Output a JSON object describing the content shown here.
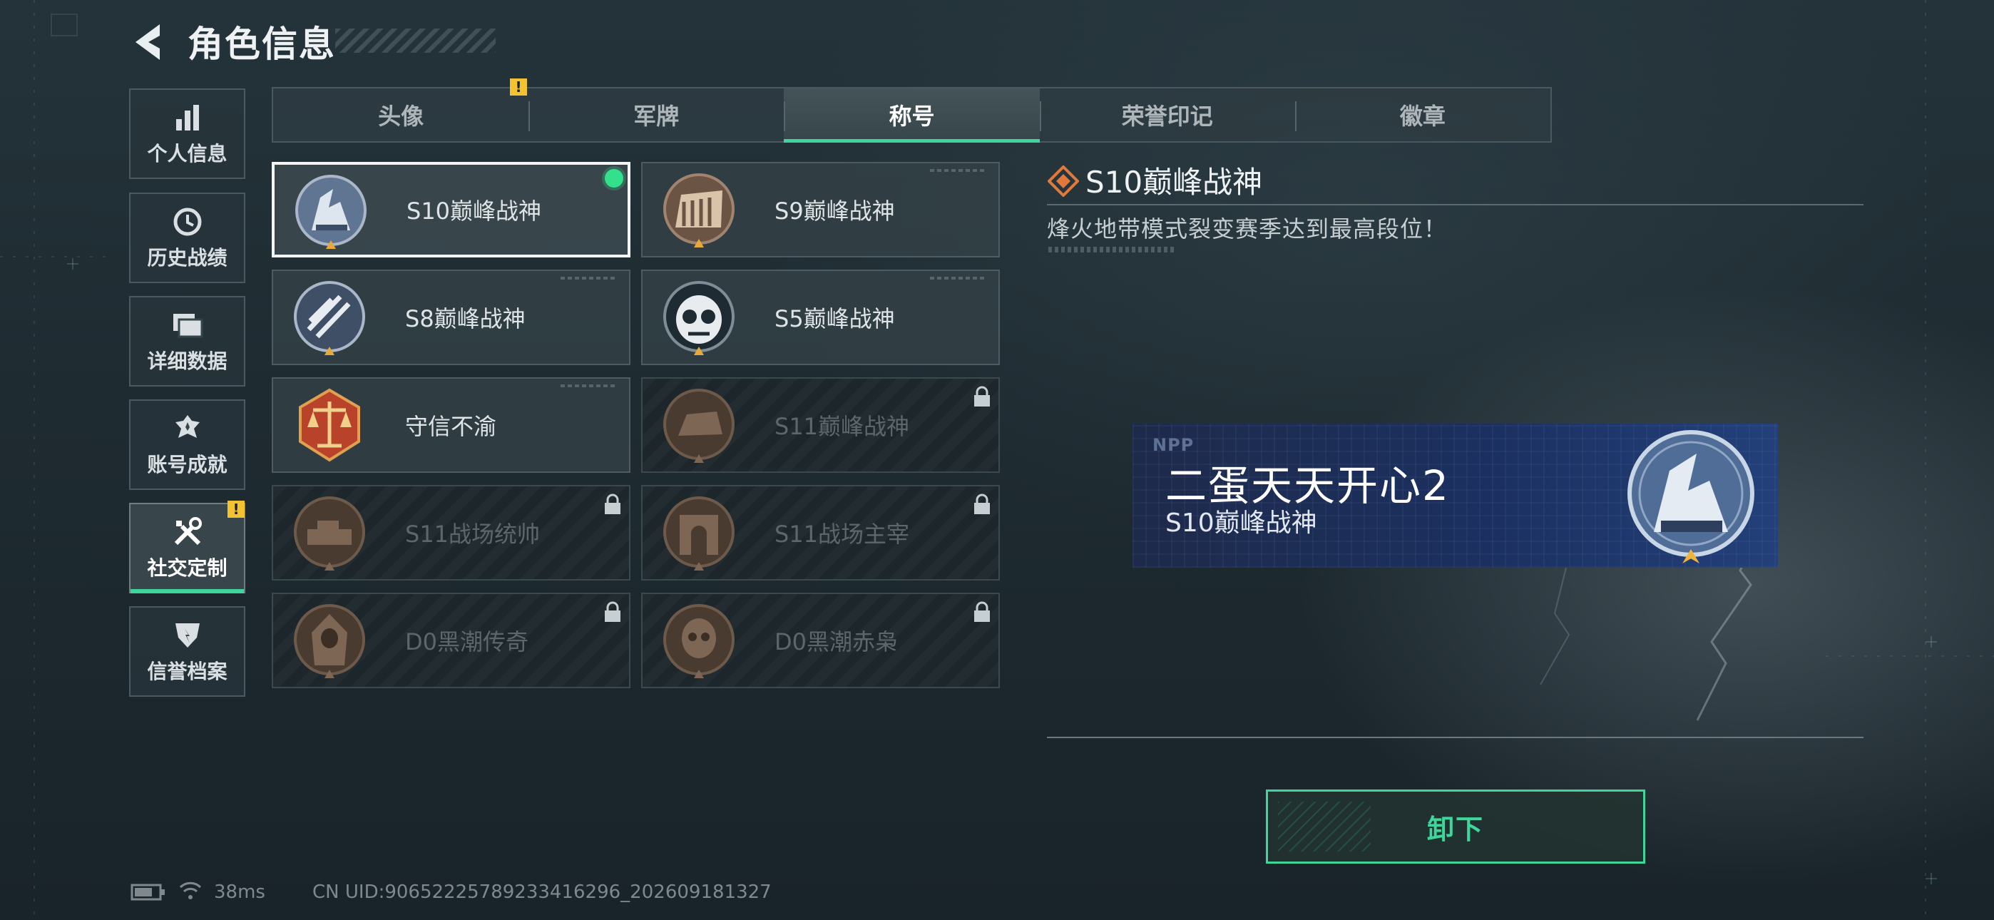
{
  "header": {
    "title": "角色信息"
  },
  "sidebar": {
    "items": [
      {
        "label": "个人信息",
        "icon": "bar-chart-icon"
      },
      {
        "label": "历史战绩",
        "icon": "clock-icon"
      },
      {
        "label": "详细数据",
        "icon": "folder-icon"
      },
      {
        "label": "账号成就",
        "icon": "achievement-icon"
      },
      {
        "label": "社交定制",
        "icon": "tools-icon",
        "active": true,
        "alert": "!"
      },
      {
        "label": "信誉档案",
        "icon": "shield-icon"
      }
    ]
  },
  "tabs": {
    "items": [
      {
        "label": "头像"
      },
      {
        "label": "军牌"
      },
      {
        "label": "称号",
        "active": true
      },
      {
        "label": "荣誉印记"
      },
      {
        "label": "徽章"
      }
    ],
    "alert": "!"
  },
  "titles": [
    {
      "name": "S10巅峰战神",
      "state": "equipped",
      "icon": "s10-emblem-icon"
    },
    {
      "name": "S9巅峰战神",
      "state": "owned",
      "icon": "s9-emblem-icon"
    },
    {
      "name": "S8巅峰战神",
      "state": "owned",
      "icon": "s8-emblem-icon"
    },
    {
      "name": "S5巅峰战神",
      "state": "owned",
      "icon": "s5-emblem-icon"
    },
    {
      "name": "守信不渝",
      "state": "owned",
      "icon": "scales-emblem-icon"
    },
    {
      "name": "S11巅峰战神",
      "state": "locked",
      "icon": "s11-emblem-icon"
    },
    {
      "name": "S11战场统帅",
      "state": "locked",
      "icon": "tank-emblem-icon"
    },
    {
      "name": "S11战场主宰",
      "state": "locked",
      "icon": "arch-emblem-icon"
    },
    {
      "name": "D0黑潮传奇",
      "state": "locked",
      "icon": "hooded-emblem-icon"
    },
    {
      "name": "D0黑潮赤枭",
      "state": "locked",
      "icon": "skull-emblem-icon"
    }
  ],
  "detail": {
    "title": "S10巅峰战神",
    "description": "烽火地带模式裂变赛季达到最高段位！"
  },
  "banner": {
    "logo": "NPP",
    "player_name": "二蛋天天开心2",
    "title": "S10巅峰战神"
  },
  "actions": {
    "unequip_label": "卸下"
  },
  "status_bar": {
    "ping": "38ms",
    "uid": "CN UID:9065222578923341629​6_202609181327"
  },
  "colors": {
    "accent": "#3ed69a",
    "warning": "#f2c230",
    "equipped": "#33e08b"
  }
}
